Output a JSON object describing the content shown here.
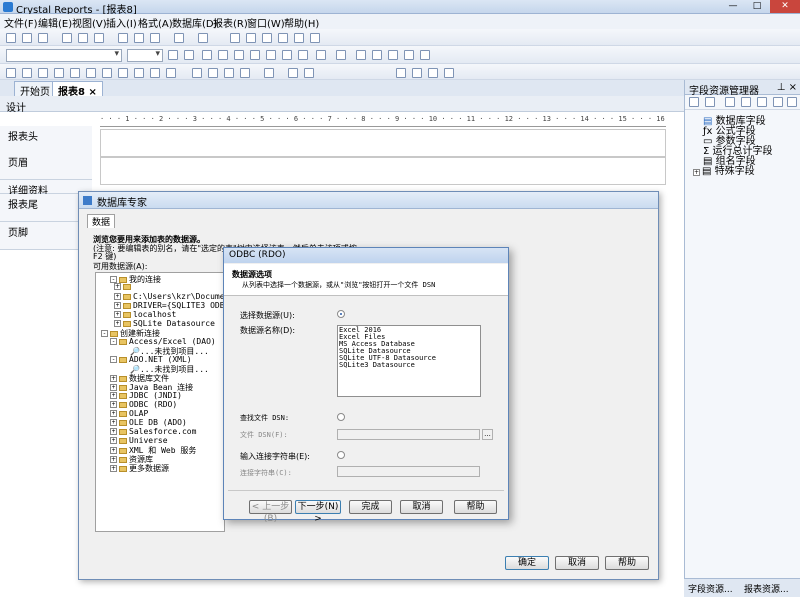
{
  "app": {
    "title": "Crystal Reports - [报表8]"
  },
  "window_controls": {
    "minimize": "—",
    "maximize": "□",
    "close": "✕"
  },
  "menu": [
    "文件(F)",
    "编辑(E)",
    "视图(V)",
    "插入(I)",
    "格式(A)",
    "数据库(D)",
    "报表(R)",
    "窗口(W)",
    "帮助(H)"
  ],
  "toolbar": {
    "font_name": "",
    "font_size": ""
  },
  "tabs": {
    "start": "开始页",
    "report": "报表8",
    "close": "×"
  },
  "design_tab": "设计",
  "sections": [
    "报表头",
    "页眉",
    "详细资料",
    "报表尾",
    "页脚"
  ],
  "ruler": "· · · 1 · · · 2 · · · 3 · · · 4 · · · 5 · · · 6 · · · 7 · · · 8 · · · 9 · · · 10 · · · 11 · · · 12 · · · 13 · · · 14 · · · 15 · · · 16 · · · 17 · · · 18 · · · 19 · · ·",
  "field_explorer": {
    "title": "字段资源管理器",
    "pin": "⊥ ×",
    "items": [
      "数据库字段",
      "公式字段",
      "参数字段",
      "运行总计字段",
      "组名字段",
      "特殊字段"
    ],
    "bottom_tabs": [
      "字段资源...",
      "报表资源..."
    ]
  },
  "db_expert": {
    "title": "数据库专家",
    "tab": "数据",
    "heading": "浏览您要用来添加表的数据源。",
    "note": "(注意: 要编辑表的别名，请在\"选定的表\"树中选择该表，然后单击该项或按",
    "note2": "F2 键)",
    "available_label": "可用数据源(A):",
    "tree": [
      "我的连接",
      "C:\\Users\\kzr\\Documents\\Gr",
      "DRIVER={SQLITE3 ODBC DRIVE",
      "localhost",
      "SQLite Datasource",
      "创建新连接",
      "Access/Excel (DAO)",
      "...未找到项目...",
      "ADO.NET (XML)",
      "...未找到项目...",
      "数据库文件",
      "Java Bean 连接",
      "JDBC (JNDI)",
      "ODBC (RDO)",
      "OLAP",
      "OLE DB (ADO)",
      "Salesforce.com",
      "Universe",
      "XML 和 Web 服务",
      "资源库",
      "更多数据源"
    ],
    "buttons": {
      "ok": "确定",
      "cancel": "取消",
      "help": "帮助"
    }
  },
  "odbc": {
    "title": "ODBC (RDO)",
    "section_title": "数据源选项",
    "section_desc": "从列表中选择一个数据源，或从\"浏览\"按钮打开一个文件 DSN",
    "select_ds": "选择数据源(U):",
    "ds_name_label": "数据源名称(D):",
    "ds_list": [
      "Excel 2016",
      "Excel Files",
      "MS Access Database",
      "SQLite Datasource",
      "SQLite UTF-8 Datasource",
      "SQLite3 Datasource"
    ],
    "find_dsn": "查找文件 DSN:",
    "file_dsn": "文件 DSN(F):",
    "enter_conn": "输入连接字符串(E):",
    "conn_string": "连接字符串(C):",
    "browse": "...",
    "buttons": {
      "back": "< 上一步(B)",
      "next": "下一步(N) >",
      "finish": "完成",
      "cancel": "取消",
      "help": "帮助"
    }
  }
}
